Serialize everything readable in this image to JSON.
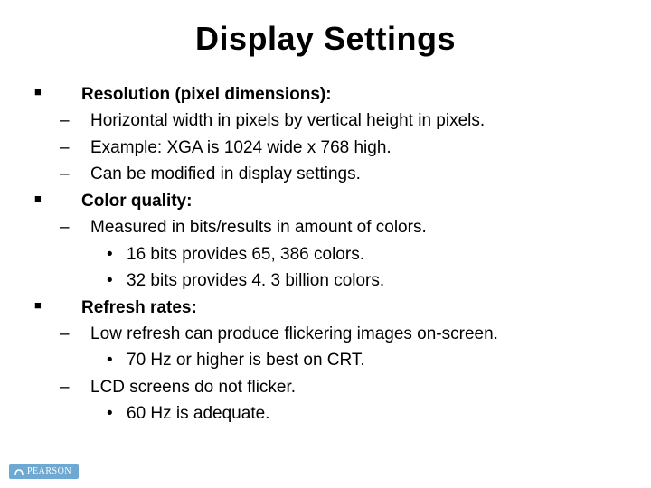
{
  "title": "Display Settings",
  "sections": [
    {
      "heading": "Resolution (pixel dimensions):",
      "dashes": [
        {
          "text": "Horizontal width in pixels by vertical height in pixels.",
          "dots": []
        },
        {
          "text": "Example: XGA is 1024 wide x 768 high.",
          "dots": []
        },
        {
          "text": "Can be modified in display settings.",
          "dots": []
        }
      ]
    },
    {
      "heading": "Color quality:",
      "dashes": [
        {
          "text": "Measured in bits/results in amount of colors.",
          "dots": [
            "16 bits provides 65, 386 colors.",
            "32 bits provides 4. 3 billion colors."
          ]
        }
      ]
    },
    {
      "heading": "Refresh rates:",
      "dashes": [
        {
          "text": "Low refresh can produce flickering images on-screen.",
          "dots": [
            "70 Hz or higher is best on CRT."
          ]
        },
        {
          "text": "LCD screens do not flicker.",
          "dots": [
            "60 Hz is adequate."
          ]
        }
      ]
    }
  ],
  "footer": {
    "brand": "PEARSON"
  },
  "glyphs": {
    "square": "■",
    "dash": "–",
    "dot": "•"
  }
}
